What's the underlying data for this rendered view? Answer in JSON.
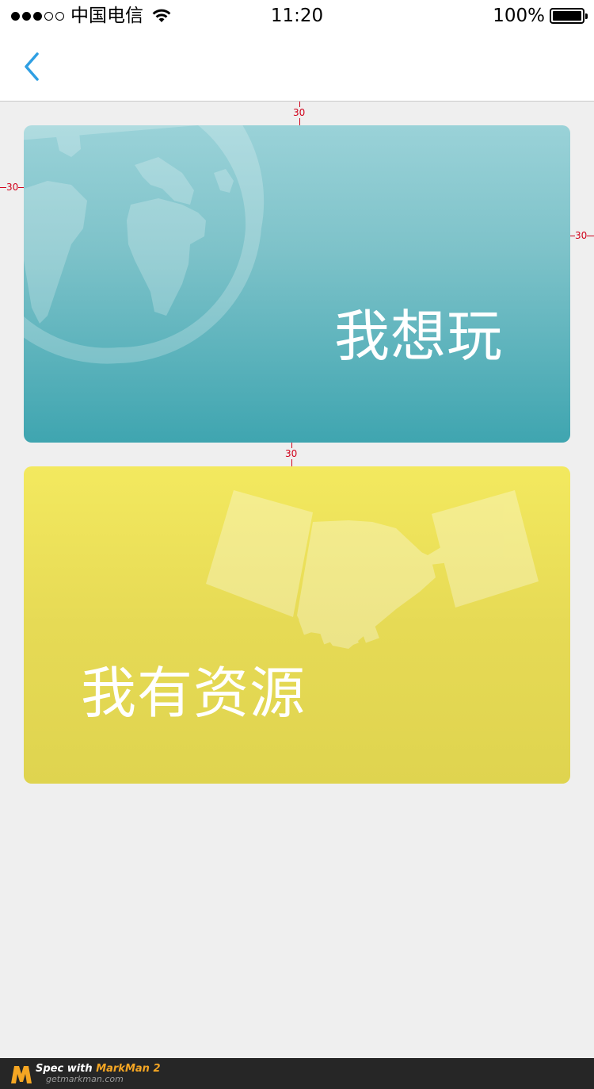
{
  "status_bar": {
    "carrier": "中国电信",
    "time": "11:20",
    "battery": "100%"
  },
  "nav": {
    "back_icon": "chevron-left-icon",
    "back_color": "#2f9fe3"
  },
  "cards": [
    {
      "label": "我想玩",
      "icon": "globe-icon",
      "color": "#56b0b9"
    },
    {
      "label": "我有资源",
      "icon": "handshake-icon",
      "color": "#e6da55"
    }
  ],
  "spec_annotations": {
    "gap_top": "30",
    "margin_left": "30",
    "margin_right": "30",
    "gap_between": "30"
  },
  "watermark": {
    "line1_prefix": "Spec with ",
    "line1_brand": "MarkMan 2",
    "line2": "getmarkman.com"
  }
}
